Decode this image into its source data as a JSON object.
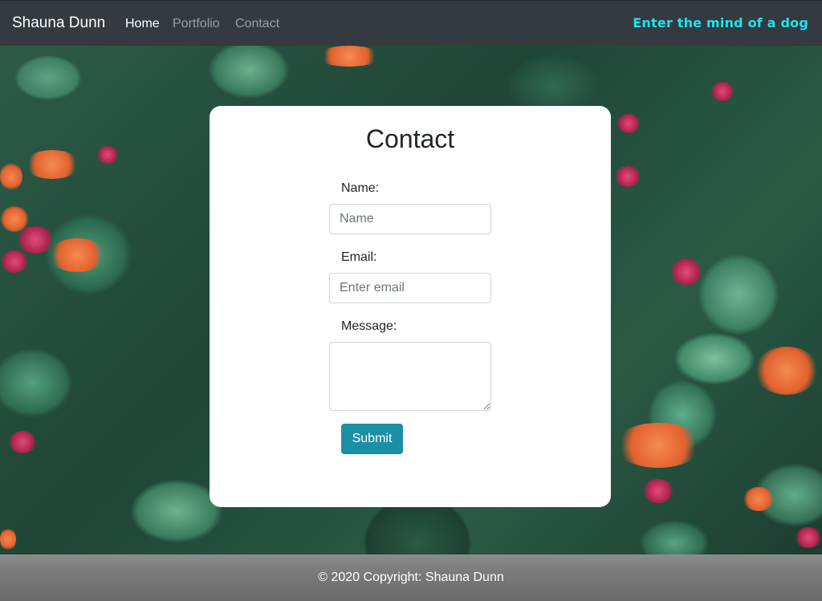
{
  "navbar": {
    "brand": "Shauna Dunn",
    "links": [
      {
        "label": "Home",
        "active": true
      },
      {
        "label": "Portfolio",
        "active": false
      },
      {
        "label": "Contact",
        "active": false
      }
    ],
    "tagline": "Enter the mind of a dog",
    "tagline_color": "#1be3f0",
    "background_color": "#343a40"
  },
  "contact_form": {
    "title": "Contact",
    "name_label": "Name:",
    "name_placeholder": "Name",
    "name_value": "",
    "email_label": "Email:",
    "email_placeholder": "Enter email",
    "email_value": "",
    "message_label": "Message:",
    "message_value": "",
    "submit_label": "Submit",
    "submit_color": "#1b8fa6"
  },
  "footer": {
    "text": "© 2020 Copyright: Shauna Dunn"
  }
}
